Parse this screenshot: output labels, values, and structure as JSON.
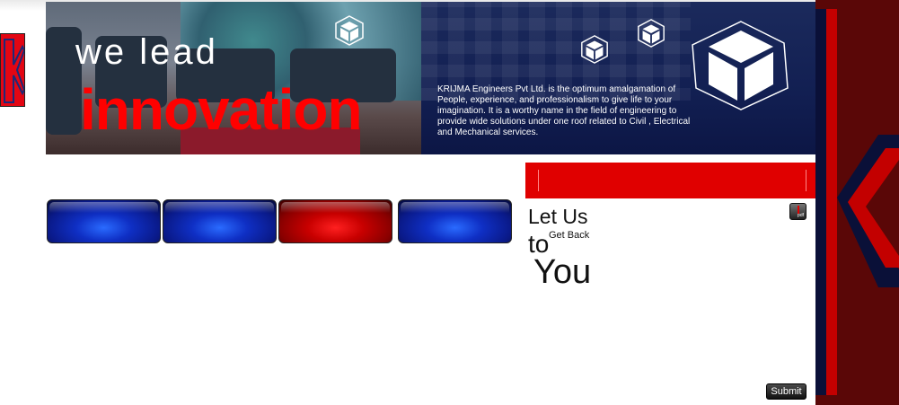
{
  "hero": {
    "tagline_line1": "we lead",
    "tagline_line2": "innovation",
    "description": "KRIJMA Engineers Pvt Ltd. is  the optimum amalgamation of People, experience, and professionalism to give life to your imagination. It is a worthy name in the field of engineering to provide wide solutions under one roof related to Civil , Electrical and Mechanical services."
  },
  "nav_tabs": [
    {
      "label": "",
      "color": "blue",
      "active": false
    },
    {
      "label": "",
      "color": "blue",
      "active": false
    },
    {
      "label": "",
      "color": "red",
      "active": true
    },
    {
      "label": "",
      "color": "blue",
      "active": false
    }
  ],
  "contact": {
    "title_line1": "Let Us",
    "small_text": "Get Back",
    "title_line2": "to",
    "title_line3": "You",
    "pdf_icon": "pdf-icon",
    "pdf_label": "pdf",
    "submit_label": "Submit"
  },
  "colors": {
    "brand_red": "#e00000",
    "navy": "#121f52",
    "dark_red": "#5a0707"
  }
}
